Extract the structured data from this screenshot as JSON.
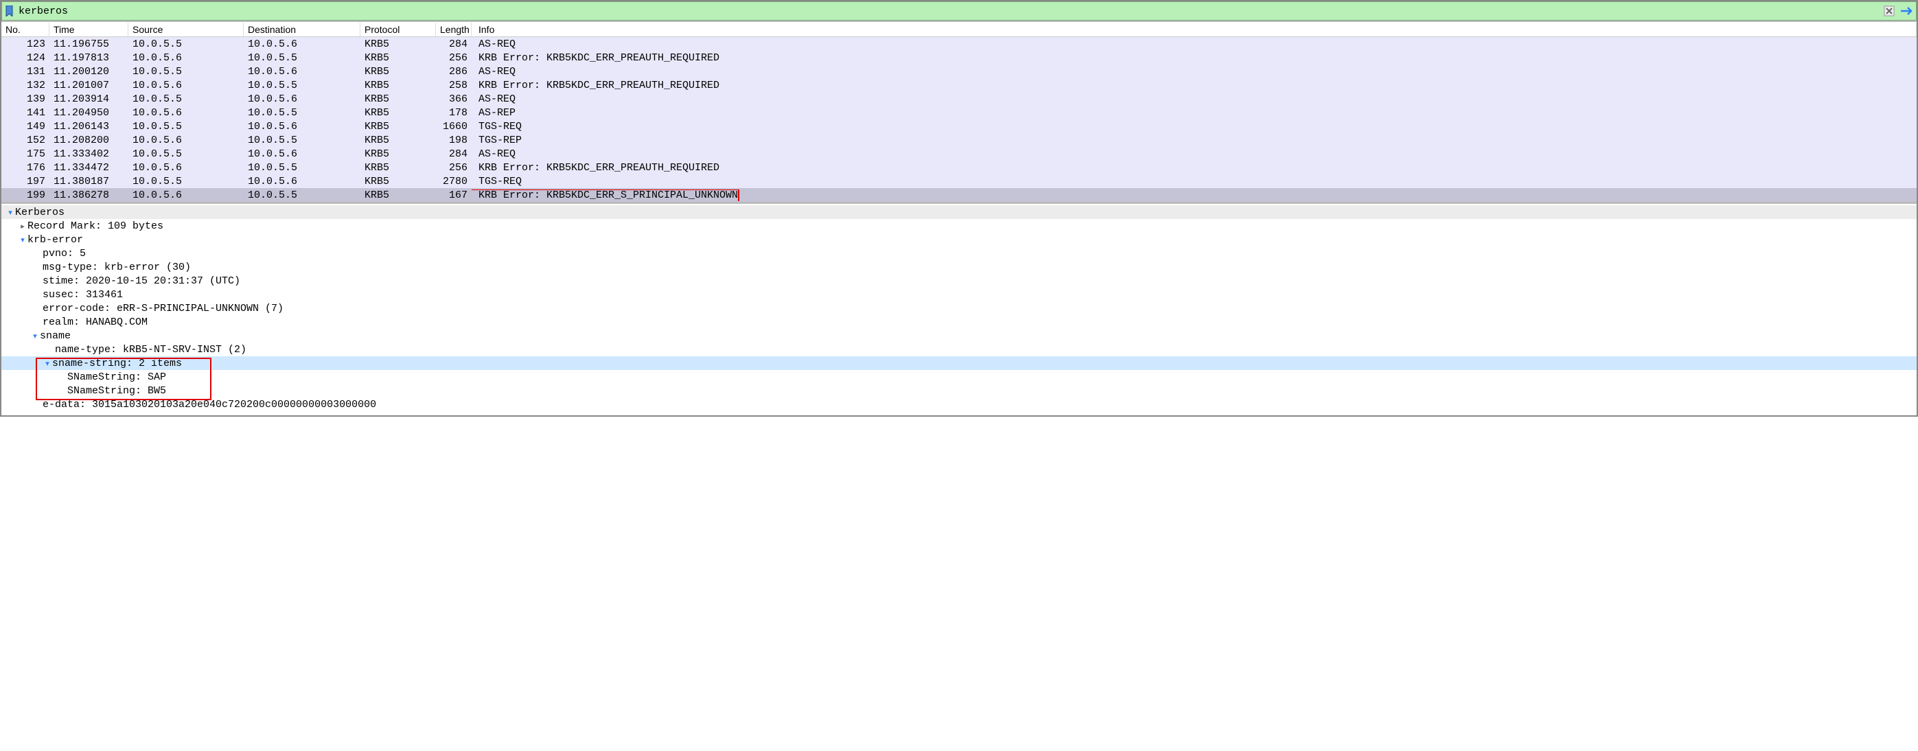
{
  "filter": {
    "value": "kerberos"
  },
  "columns": [
    "No.",
    "Time",
    "Source",
    "Destination",
    "Protocol",
    "Length",
    "Info"
  ],
  "packets": [
    {
      "no": "123",
      "time": "11.196755",
      "src": "10.0.5.5",
      "dst": "10.0.5.6",
      "proto": "KRB5",
      "len": "284",
      "info": "AS-REQ",
      "selected": false
    },
    {
      "no": "124",
      "time": "11.197813",
      "src": "10.0.5.6",
      "dst": "10.0.5.5",
      "proto": "KRB5",
      "len": "256",
      "info": "KRB Error: KRB5KDC_ERR_PREAUTH_REQUIRED",
      "selected": false
    },
    {
      "no": "131",
      "time": "11.200120",
      "src": "10.0.5.5",
      "dst": "10.0.5.6",
      "proto": "KRB5",
      "len": "286",
      "info": "AS-REQ",
      "selected": false
    },
    {
      "no": "132",
      "time": "11.201007",
      "src": "10.0.5.6",
      "dst": "10.0.5.5",
      "proto": "KRB5",
      "len": "258",
      "info": "KRB Error: KRB5KDC_ERR_PREAUTH_REQUIRED",
      "selected": false
    },
    {
      "no": "139",
      "time": "11.203914",
      "src": "10.0.5.5",
      "dst": "10.0.5.6",
      "proto": "KRB5",
      "len": "366",
      "info": "AS-REQ",
      "selected": false
    },
    {
      "no": "141",
      "time": "11.204950",
      "src": "10.0.5.6",
      "dst": "10.0.5.5",
      "proto": "KRB5",
      "len": "178",
      "info": "AS-REP",
      "selected": false
    },
    {
      "no": "149",
      "time": "11.206143",
      "src": "10.0.5.5",
      "dst": "10.0.5.6",
      "proto": "KRB5",
      "len": "1660",
      "info": "TGS-REQ",
      "selected": false
    },
    {
      "no": "152",
      "time": "11.208200",
      "src": "10.0.5.6",
      "dst": "10.0.5.5",
      "proto": "KRB5",
      "len": "198",
      "info": "TGS-REP",
      "selected": false
    },
    {
      "no": "175",
      "time": "11.333402",
      "src": "10.0.5.5",
      "dst": "10.0.5.6",
      "proto": "KRB5",
      "len": "284",
      "info": "AS-REQ",
      "selected": false
    },
    {
      "no": "176",
      "time": "11.334472",
      "src": "10.0.5.6",
      "dst": "10.0.5.5",
      "proto": "KRB5",
      "len": "256",
      "info": "KRB Error: KRB5KDC_ERR_PREAUTH_REQUIRED",
      "selected": false
    },
    {
      "no": "197",
      "time": "11.380187",
      "src": "10.0.5.5",
      "dst": "10.0.5.6",
      "proto": "KRB5",
      "len": "2780",
      "info": "TGS-REQ",
      "selected": false
    },
    {
      "no": "199",
      "time": "11.386278",
      "src": "10.0.5.6",
      "dst": "10.0.5.5",
      "proto": "KRB5",
      "len": "167",
      "info": "KRB Error: KRB5KDC_ERR_S_PRINCIPAL_UNKNOWN",
      "selected": true,
      "highlight_info": true
    }
  ],
  "details": {
    "protocol_label": "Kerberos",
    "record_mark": "Record Mark: 109 bytes",
    "krb_error_label": "krb-error",
    "pvno": "pvno: 5",
    "msg_type": "msg-type: krb-error (30)",
    "stime": "stime: 2020-10-15 20:31:37 (UTC)",
    "susec": "susec: 313461",
    "error_code": "error-code: eRR-S-PRINCIPAL-UNKNOWN (7)",
    "realm": "realm: HANABQ.COM",
    "sname_label": "sname",
    "name_type": "name-type: kRB5-NT-SRV-INST (2)",
    "sname_string": "sname-string: 2 items",
    "sname_item_0": "SNameString: SAP",
    "sname_item_1": "SNameString: BW5",
    "e_data": "e-data: 3015a103020103a20e040c720200c00000000003000000"
  }
}
